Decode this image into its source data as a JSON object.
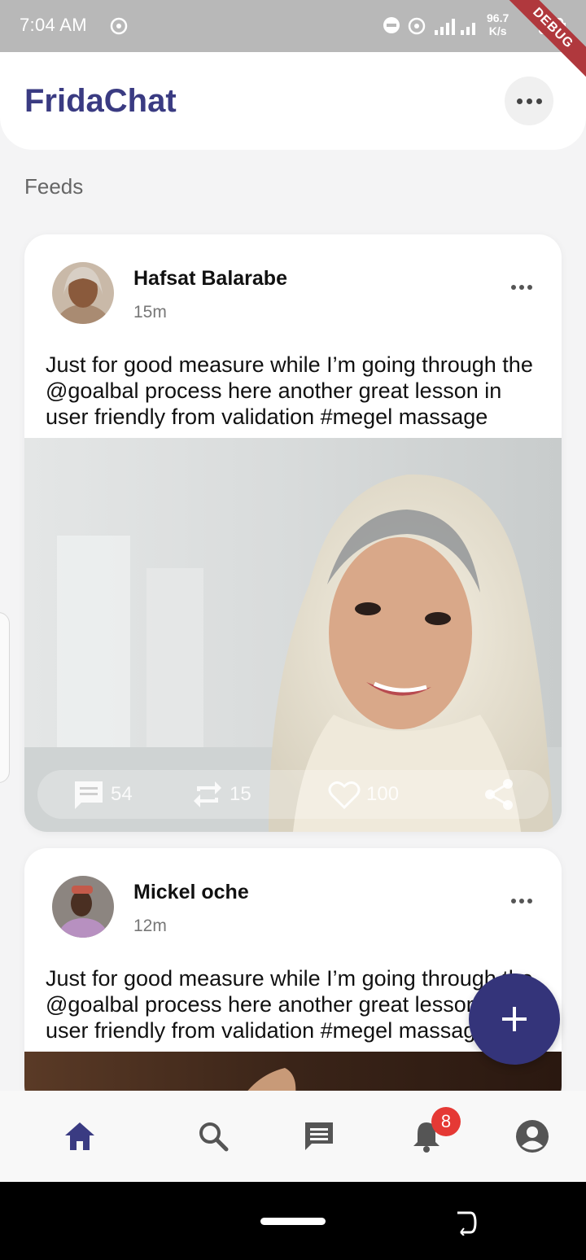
{
  "status_bar": {
    "time": "7:04 AM",
    "network_speed_value": "96.7",
    "network_speed_unit": "K/s",
    "network_type": "4G",
    "debug_banner": "DEBUG"
  },
  "header": {
    "title": "FridaChat",
    "menu_icon": "more-horizontal-icon"
  },
  "section_title": "Feeds",
  "posts": [
    {
      "author": "Hafsat Balarabe",
      "time": "15m",
      "text": "Just for good measure while I’m going through the @goalbal process here another great lesson in user friendly from validation #megel massage",
      "comments": "54",
      "reposts": "15",
      "likes": "100"
    },
    {
      "author": "Mickel oche",
      "time": "12m",
      "text": "Just for good measure while I’m going through the @goalbal process here another great lesson in user friendly from validation #megel massage"
    }
  ],
  "bottom_nav": {
    "items": [
      "home-icon",
      "search-icon",
      "chat-icon",
      "bell-icon",
      "profile-icon"
    ],
    "active": "home",
    "notification_badge": "8"
  },
  "colors": {
    "primary": "#3a3b82",
    "fab": "#34347a",
    "badge": "#e53935",
    "background": "#f4f4f5"
  }
}
